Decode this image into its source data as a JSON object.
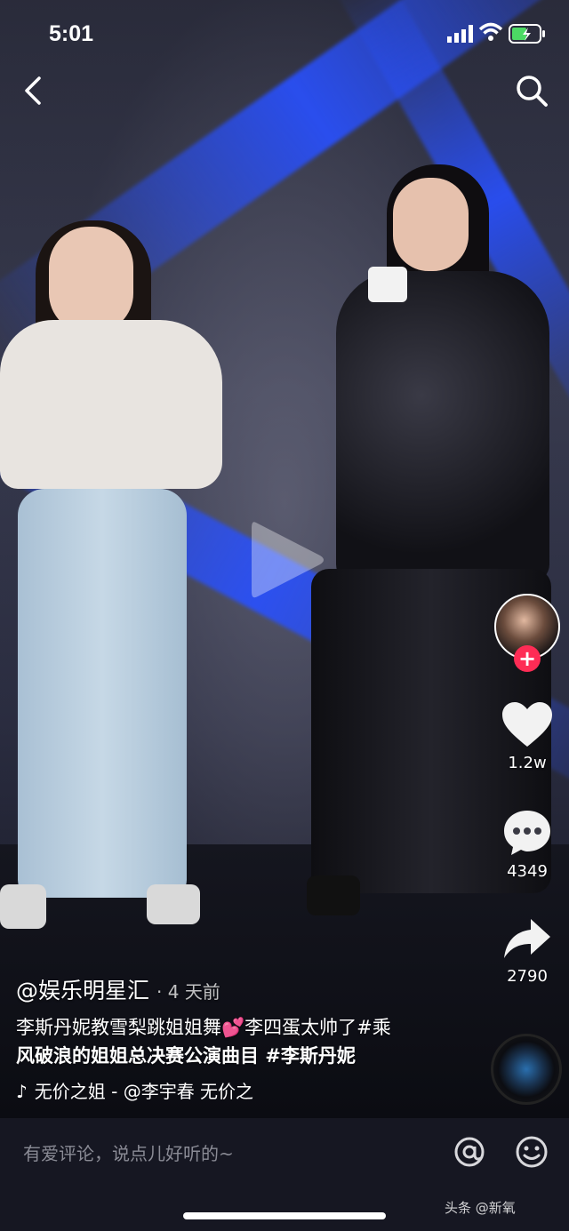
{
  "status_bar": {
    "time": "5:01"
  },
  "post": {
    "author": "@娱乐明星汇",
    "time_ago": "· 4 天前",
    "caption_line1": "李斯丹妮教雪梨跳姐姐舞💕李四蛋太帅了#乘",
    "caption_line2": "风破浪的姐姐总决赛公演曲目 #李斯丹妮",
    "music": "无价之姐 - @李宇春    无价之"
  },
  "rail": {
    "likes": "1.2w",
    "comments": "4349",
    "shares": "2790"
  },
  "comment_bar": {
    "placeholder": "有爱评论，说点儿好听的~"
  },
  "watermark": "头条 @新氧",
  "icons": [
    "back-icon",
    "search-icon",
    "play-icon",
    "heart-icon",
    "comment-icon",
    "share-icon",
    "music-note-icon",
    "at-icon",
    "emoji-icon"
  ]
}
